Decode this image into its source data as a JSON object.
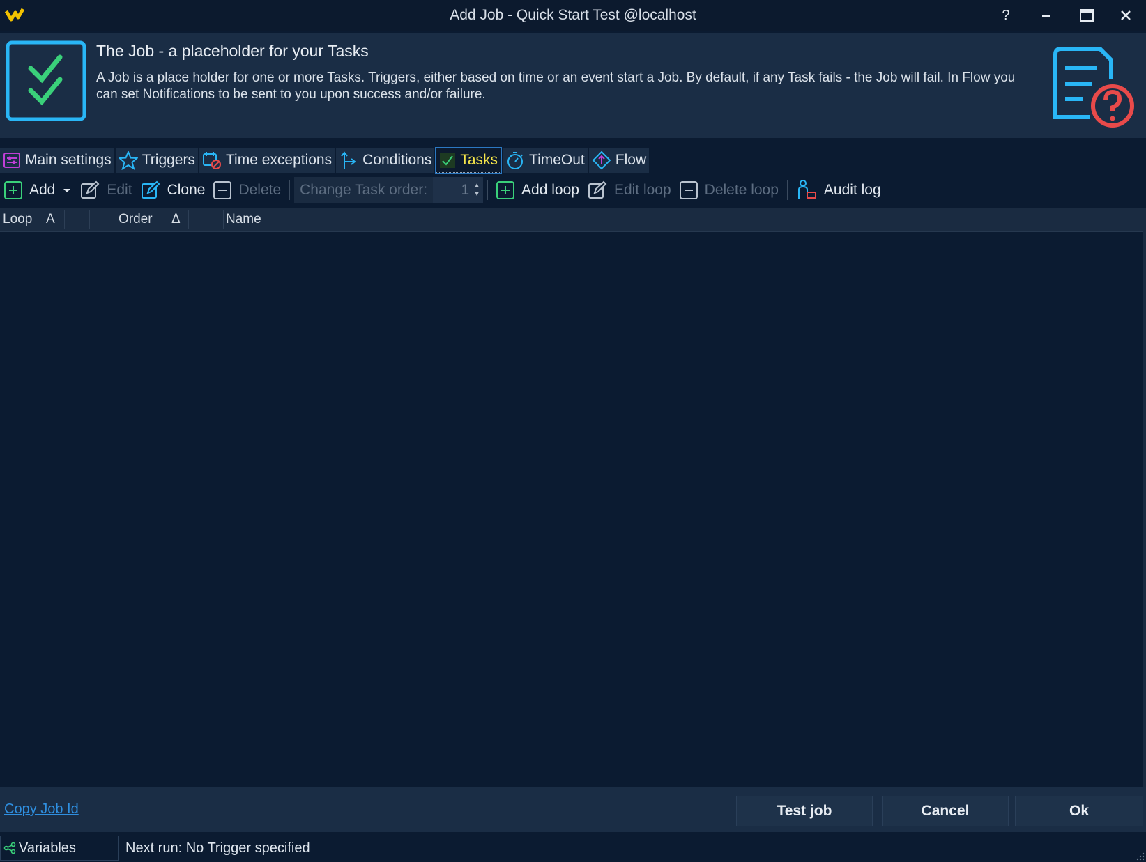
{
  "window": {
    "title": "Add Job - Quick Start Test @localhost",
    "controls": [
      "?",
      "minimize",
      "maximize",
      "close"
    ]
  },
  "header": {
    "title": "The Job - a placeholder for your Tasks",
    "description": "A Job is a place holder for one or more Tasks. Triggers, either based on time or an event start a Job. By default, if any Task fails - the Job will fail. In Flow you can set Notifications to be sent to you upon success and/or failure."
  },
  "tabs": [
    {
      "label": "Main settings",
      "icon": "settings-icon"
    },
    {
      "label": "Triggers",
      "icon": "star-icon"
    },
    {
      "label": "Time exceptions",
      "icon": "calendar-cancel-icon"
    },
    {
      "label": "Conditions",
      "icon": "conditions-icon"
    },
    {
      "label": "Tasks",
      "icon": "check-icon",
      "active": true
    },
    {
      "label": "TimeOut",
      "icon": "stopwatch-icon"
    },
    {
      "label": "Flow",
      "icon": "diamond-icon"
    }
  ],
  "toolbar": {
    "add": "Add",
    "edit": "Edit",
    "clone": "Clone",
    "delete": "Delete",
    "change_order": "Change Task order:",
    "order_value": "1",
    "add_loop": "Add loop",
    "edit_loop": "Edit loop",
    "delete_loop": "Delete loop",
    "audit_log": "Audit log"
  },
  "grid": {
    "columns": {
      "loop": "Loop",
      "loop_sort": "A",
      "order": "Order",
      "order_sort": "Δ",
      "name": "Name"
    },
    "rows": []
  },
  "footer": {
    "copy_job_id": "Copy Job Id",
    "test_job": "Test job",
    "cancel": "Cancel",
    "ok": "Ok"
  },
  "statusbar": {
    "variables": "Variables",
    "next_run": "Next run: No Trigger specified"
  },
  "colors": {
    "background": "#0b1b31",
    "panel": "#1a2d45",
    "accent": "#29b6f6",
    "active_tab_text": "#f6e64a",
    "link": "#2f8fe0",
    "check_green": "#3ad07a",
    "alert_red": "#e84a4a"
  }
}
